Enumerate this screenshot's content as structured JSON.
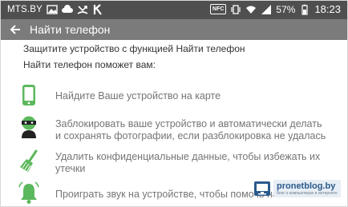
{
  "status_bar": {
    "carrier": "MTS.BY",
    "nfc": "NFC",
    "battery_percent": "57%",
    "time": "18:23",
    "left_icons": [
      "image-icon",
      "cloud-icon",
      "missed-call-icon",
      "k-app-icon"
    ],
    "right_icons": [
      "nfc-icon",
      "wifi-icon",
      "signal-icon",
      "battery-icon"
    ]
  },
  "app_bar": {
    "title": "Найти телефон",
    "back_icon": "arrow-left-icon"
  },
  "intro": {
    "line1": "Защитите устройство с функцией Найти телефон",
    "line2": "Найти телефон поможет вам:"
  },
  "features": [
    {
      "icon": "phone-icon",
      "text": "Найдите Ваше устройство на карте"
    },
    {
      "icon": "thief-icon",
      "text": "Заблокировать ваше устройство и автоматически делать и сохранять фотографии, если разблокировка не удалась"
    },
    {
      "icon": "broom-icon",
      "text": "Удалить конфиденциальные данные, чтобы избежать их утечки"
    },
    {
      "icon": "bell-icon",
      "text": "Проиграть звук на устройстве, чтобы помочь найти его"
    }
  ],
  "watermark": {
    "name": "pronetblog.by",
    "sub": "блог о компьютерах и интернете"
  },
  "colors": {
    "status_bar": "#4f4f4f",
    "app_bar": "#7b7b7b",
    "accent_green": "#5cb85c",
    "feature_text": "#757575"
  }
}
